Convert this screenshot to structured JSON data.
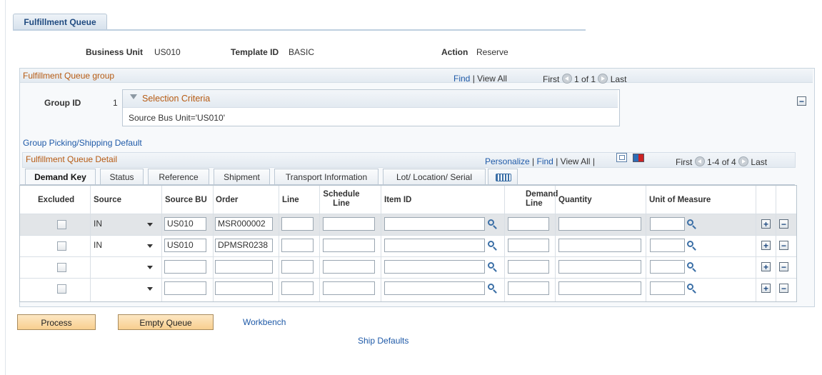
{
  "page_tab": "Fulfillment Queue",
  "header": {
    "business_unit_label": "Business Unit",
    "business_unit_value": "US010",
    "template_id_label": "Template ID",
    "template_id_value": "BASIC",
    "action_label": "Action",
    "action_value": "Reserve"
  },
  "group": {
    "title": "Fulfillment Queue group",
    "find": "Find",
    "view_all": "View All",
    "first": "First",
    "range": "1 of 1",
    "last": "Last",
    "group_id_label": "Group ID",
    "group_id_value": "1",
    "selection_criteria_title": "Selection Criteria",
    "selection_criteria_value": "Source Bus Unit='US010'",
    "group_default_link": "Group Picking/Shipping Default"
  },
  "detail": {
    "title": "Fulfillment Queue Detail",
    "personalize": "Personalize",
    "find": "Find",
    "view_all": "View All",
    "first": "First",
    "range": "1-4 of 4",
    "last": "Last",
    "tabs": [
      "Demand Key",
      "Status",
      "Reference",
      "Shipment",
      "Transport Information",
      "Lot/ Location/ Serial"
    ],
    "columns": {
      "excluded": "Excluded",
      "source": "Source",
      "source_bu": "Source BU",
      "order": "Order",
      "line": "Line",
      "schedule_line_1": "Schedule",
      "schedule_line_2": "Line",
      "item_id": "Item ID",
      "demand_line_1": "Demand",
      "demand_line_2": "Line",
      "quantity": "Quantity",
      "uom": "Unit of Measure"
    },
    "rows": [
      {
        "source": "IN",
        "source_bu": "US010",
        "order": "MSR000002"
      },
      {
        "source": "IN",
        "source_bu": "US010",
        "order": "DPMSR0238"
      },
      {
        "source": "",
        "source_bu": "",
        "order": ""
      },
      {
        "source": "",
        "source_bu": "",
        "order": ""
      }
    ]
  },
  "actions": {
    "process": "Process",
    "empty_queue": "Empty Queue",
    "workbench": "Workbench",
    "ship_defaults": "Ship Defaults"
  },
  "icons": {
    "nav_prev": "circle-left-arrow-icon",
    "nav_next": "circle-right-arrow-icon",
    "lookup": "magnifier-icon",
    "add_row": "plus-icon",
    "delete_row": "minus-icon",
    "collapse": "minus-box-icon",
    "zoom": "zoom-grid-icon",
    "download": "download-spreadsheet-icon",
    "show_all_columns": "show-all-columns-icon"
  }
}
